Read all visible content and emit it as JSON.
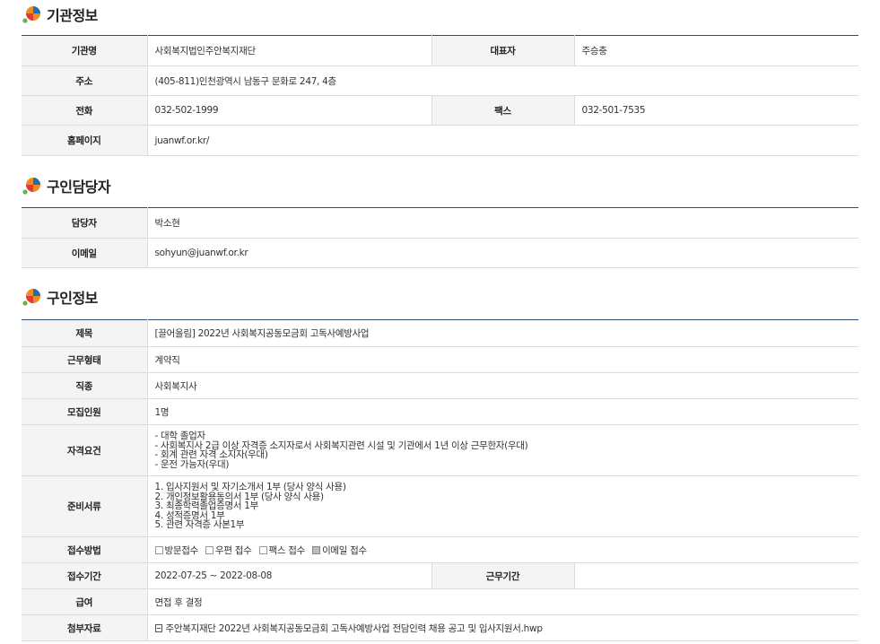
{
  "sections": {
    "org": {
      "title": "기관정보",
      "name_label": "기관명",
      "name_value": "사회복지법인주안복지재단",
      "rep_label": "대표자",
      "rep_value": "주승충",
      "addr_label": "주소",
      "addr_value": "(405-811)인천광역시 남동구 문화로 247, 4층",
      "phone_label": "전화",
      "phone_value": "032-502-1999",
      "fax_label": "팩스",
      "fax_value": "032-501-7535",
      "web_label": "홈페이지",
      "web_value": "juanwf.or.kr/"
    },
    "contact": {
      "title": "구인담당자",
      "person_label": "담당자",
      "person_value": "박소현",
      "email_label": "이메일",
      "email_value": "sohyun@juanwf.or.kr"
    },
    "job": {
      "title": "구인정보",
      "subject_label": "제목",
      "subject_value": "[끌어올림] 2022년 사회복지공동모금회 고독사예방사업",
      "type_label": "근무형태",
      "type_value": "계약직",
      "occupation_label": "직종",
      "occupation_value": "사회복지사",
      "count_label": "모집인원",
      "count_value": "1명",
      "qual_label": "자격요건",
      "qual_lines": [
        "- 대학 졸업자",
        "- 사회복지사 2급 이상 자격증 소지자로서 사회복지관련 시설 및 기관에서 1년 이상 근무한자(우대)",
        "- 회계 관련 자격 소지자(우대)",
        "- 운전 가능자(우대)"
      ],
      "docs_label": "준비서류",
      "docs_lines": [
        "1. 입사지원서 및 자기소개서 1부 (당사 양식 사용)",
        "2. 개인정보활용동의서 1부 (당사 양식 사용)",
        "3. 최종학력졸업증명서 1부",
        "4. 성적증명서 1부",
        "5. 관련 자격증 사본1부"
      ],
      "method_label": "접수방법",
      "methods": [
        {
          "label": "방문접수",
          "checked": false
        },
        {
          "label": "우편 접수",
          "checked": false
        },
        {
          "label": "팩스 접수",
          "checked": false
        },
        {
          "label": "이메일 접수",
          "checked": true
        }
      ],
      "period_label": "접수기간",
      "period_value": "2022-07-25 ~ 2022-08-08",
      "workperiod_label": "근무기간",
      "workperiod_value": "",
      "salary_label": "급여",
      "salary_value": "면접 후 결정",
      "attach_label": "첨부자료",
      "attach_value": "주안복지재단 2022년 사회복지공동모금회 고독사예방사업 전담인력 채용 공고 및 입사지원서.hwp",
      "attach_icon": "file-icon"
    }
  },
  "colors": {
    "header_line": "#2f4e6f",
    "label_bg": "#f4f4f4",
    "border": "#dcdcdc"
  }
}
